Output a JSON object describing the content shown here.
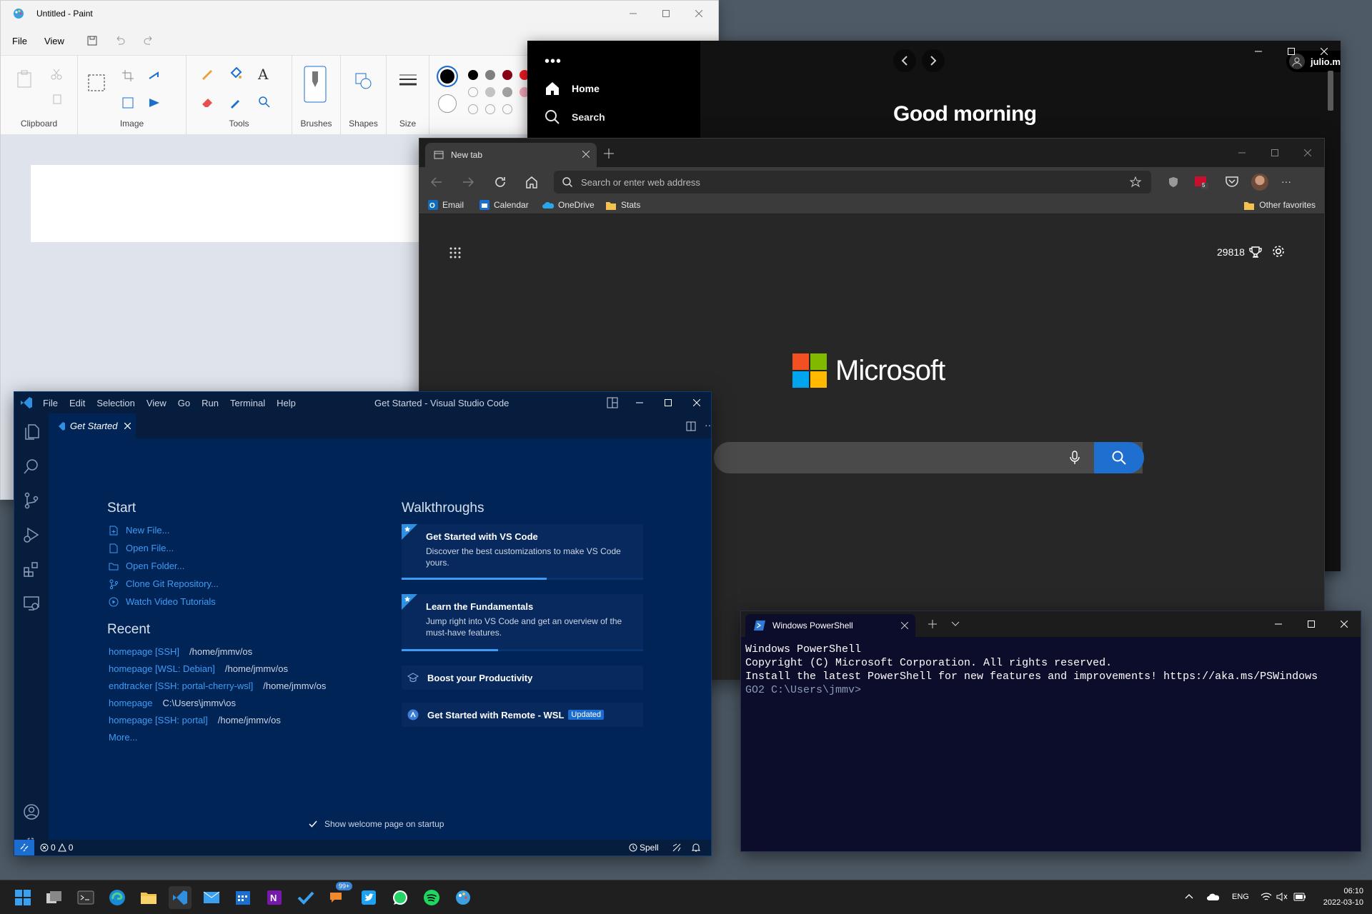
{
  "paint": {
    "title": "Untitled - Paint",
    "menu": [
      "File",
      "View"
    ],
    "groups": [
      "Clipboard",
      "Image",
      "Tools",
      "Brushes",
      "Shapes",
      "Size"
    ]
  },
  "spotify": {
    "nav": [
      "Home",
      "Search"
    ],
    "user": "julio.merino",
    "greeting": "Good morning"
  },
  "edge": {
    "tab_title": "New tab",
    "address_placeholder": "Search or enter web address",
    "favorites": [
      "Email",
      "Calendar",
      "OneDrive",
      "Stats"
    ],
    "other_favorites": "Other favorites",
    "rewards_points": "29818",
    "brand": "Microsoft",
    "ext_badge": "5"
  },
  "vscode": {
    "menu": [
      "File",
      "Edit",
      "Selection",
      "View",
      "Go",
      "Run",
      "Terminal",
      "Help"
    ],
    "title": "Get Started - Visual Studio Code",
    "tab": "Get Started",
    "start_heading": "Start",
    "start_items": [
      "New File...",
      "Open File...",
      "Open Folder...",
      "Clone Git Repository...",
      "Watch Video Tutorials"
    ],
    "recent_heading": "Recent",
    "recent": [
      {
        "name": "homepage [SSH]",
        "path": "/home/jmmv/os"
      },
      {
        "name": "homepage [WSL: Debian]",
        "path": "/home/jmmv/os"
      },
      {
        "name": "endtracker [SSH: portal-cherry-wsl]",
        "path": "/home/jmmv/os"
      },
      {
        "name": "homepage",
        "path": "C:\\Users\\jmmv\\os"
      },
      {
        "name": "homepage [SSH: portal]",
        "path": "/home/jmmv/os"
      }
    ],
    "more": "More...",
    "walkthroughs_heading": "Walkthroughs",
    "walkthroughs": [
      {
        "title": "Get Started with VS Code",
        "desc": "Discover the best customizations to make VS Code yours.",
        "progress": 0.6
      },
      {
        "title": "Learn the Fundamentals",
        "desc": "Jump right into VS Code and get an overview of the must-have features.",
        "progress": 0.4
      }
    ],
    "boost": "Boost your Productivity",
    "remote": "Get Started with Remote - WSL",
    "updated_badge": "Updated",
    "show_welcome": "Show welcome page on startup",
    "status_errors": "0",
    "status_warnings": "0",
    "status_spell": "Spell"
  },
  "powershell": {
    "tab": "Windows PowerShell",
    "lines": [
      "Windows PowerShell",
      "Copyright (C) Microsoft Corporation. All rights reserved.",
      "",
      "Install the latest PowerShell for new features and improvements! https://aka.ms/PSWindows",
      ""
    ],
    "prompt": "GO2 C:\\Users\\jmmv>"
  },
  "taskbar": {
    "badge": "99+",
    "lang": "ENG",
    "time": "06:10",
    "date": "2022-03-10"
  },
  "colors": {
    "vscode_bg": "#012456",
    "edge_search_button": "#1f6fd0",
    "accent_blue": "#3d9cf5"
  }
}
